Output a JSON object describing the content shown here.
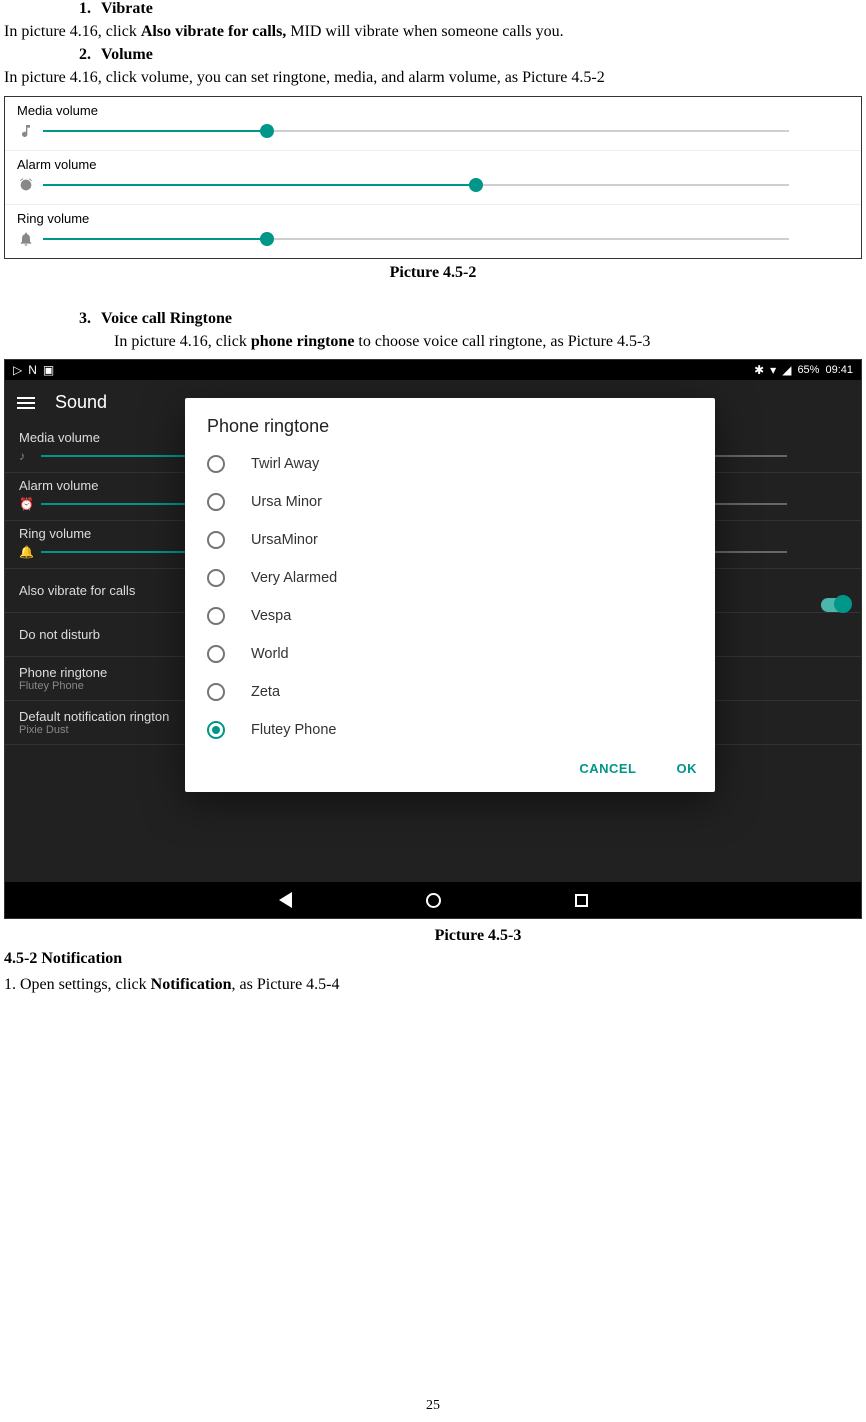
{
  "doc": {
    "item1_num": "1.",
    "item1_label": "Vibrate",
    "para1a": "In picture 4.16, click ",
    "para1b": "Also vibrate for calls,",
    "para1c": " MID will vibrate when someone calls you.",
    "item2_num": "2.",
    "item2_label": "Volume",
    "para2": "In picture 4.16, click volume, you can set ringtone, media, and alarm volume, as Picture 4.5-2",
    "caption1": "Picture 4.5-2",
    "item3_num": "3.",
    "item3_label": "Voice call Ringtone",
    "para3a": "In picture 4.16, click ",
    "para3b": "phone ringtone",
    "para3c": " to choose voice call ringtone, as Picture 4.5-3",
    "caption2": "Picture 4.5-3",
    "section_452": "4.5-2 Notification",
    "para4a": "1. Open settings, click ",
    "para4b": "Notification",
    "para4c": ", as Picture 4.5-4",
    "page_num": "25"
  },
  "fig1": {
    "rows": [
      {
        "label": "Media volume",
        "pct": 30
      },
      {
        "label": "Alarm volume",
        "pct": 58
      },
      {
        "label": "Ring volume",
        "pct": 30
      }
    ]
  },
  "fig2": {
    "status": {
      "battery": "65%",
      "time": "09:41"
    },
    "toolbar_title": "Sound",
    "bg_rows": {
      "media": "Media volume",
      "alarm": "Alarm volume",
      "ring": "Ring volume",
      "vibrate": "Also vibrate for calls",
      "dnd": "Do not disturb",
      "ringtone_label": "Phone ringtone",
      "ringtone_value": "Flutey Phone",
      "notif_label": "Default notification rington",
      "notif_value": "Pixie Dust"
    },
    "dialog": {
      "title": "Phone ringtone",
      "items": [
        "Twirl Away",
        "Ursa Minor",
        "UrsaMinor",
        "Very Alarmed",
        "Vespa",
        "World",
        "Zeta",
        "Flutey Phone"
      ],
      "selected_index": 7,
      "cancel": "CANCEL",
      "ok": "OK"
    }
  }
}
